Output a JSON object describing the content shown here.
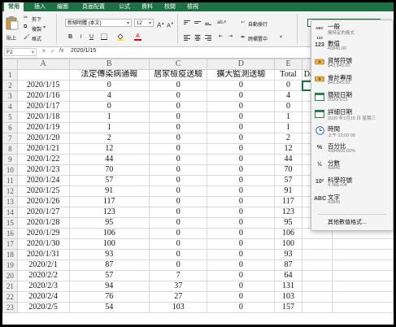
{
  "ribbon_tabs": [
    "常用",
    "插入",
    "繪圖",
    "頁面配置",
    "公式",
    "資料",
    "校閱",
    "檢視"
  ],
  "clipboard": {
    "paste": "貼上",
    "cut": "剪下",
    "copy": "複製",
    "format": "格式"
  },
  "font": {
    "name": "新細明體 (本文)",
    "size": "12"
  },
  "wrap_text": "自動換行",
  "merge_center": "跨欄置中",
  "formula_bar": {
    "cell_ref": "F2",
    "fx": "fx",
    "value": "2020/1/15"
  },
  "columns": [
    "A",
    "B",
    "C",
    "D",
    "E"
  ],
  "headers": {
    "b": "法定傳染病通報",
    "c": "居家檢疫送驗",
    "d": "擴大監測送驗",
    "e": "Total",
    "f": "Day"
  },
  "rows": [
    {
      "n": "2",
      "date": "2020/1/15",
      "b": "0",
      "c": "0",
      "d": "0",
      "e": "0"
    },
    {
      "n": "3",
      "date": "2020/1/16",
      "b": "4",
      "c": "0",
      "d": "0",
      "e": "4"
    },
    {
      "n": "4",
      "date": "2020/1/17",
      "b": "0",
      "c": "0",
      "d": "0",
      "e": "0"
    },
    {
      "n": "5",
      "date": "2020/1/18",
      "b": "1",
      "c": "0",
      "d": "0",
      "e": "1"
    },
    {
      "n": "6",
      "date": "2020/1/19",
      "b": "1",
      "c": "0",
      "d": "0",
      "e": "1"
    },
    {
      "n": "7",
      "date": "2020/1/20",
      "b": "2",
      "c": "0",
      "d": "0",
      "e": "2"
    },
    {
      "n": "8",
      "date": "2020/1/21",
      "b": "12",
      "c": "0",
      "d": "0",
      "e": "12"
    },
    {
      "n": "9",
      "date": "2020/1/22",
      "b": "44",
      "c": "0",
      "d": "0",
      "e": "44"
    },
    {
      "n": "10",
      "date": "2020/1/23",
      "b": "70",
      "c": "0",
      "d": "0",
      "e": "70"
    },
    {
      "n": "11",
      "date": "2020/1/24",
      "b": "57",
      "c": "0",
      "d": "0",
      "e": "57"
    },
    {
      "n": "12",
      "date": "2020/1/25",
      "b": "91",
      "c": "0",
      "d": "0",
      "e": "91"
    },
    {
      "n": "13",
      "date": "2020/1/26",
      "b": "117",
      "c": "0",
      "d": "0",
      "e": "117"
    },
    {
      "n": "14",
      "date": "2020/1/27",
      "b": "123",
      "c": "0",
      "d": "0",
      "e": "123"
    },
    {
      "n": "15",
      "date": "2020/1/28",
      "b": "95",
      "c": "0",
      "d": "0",
      "e": "95"
    },
    {
      "n": "16",
      "date": "2020/1/29",
      "b": "106",
      "c": "0",
      "d": "0",
      "e": "106"
    },
    {
      "n": "17",
      "date": "2020/1/30",
      "b": "100",
      "c": "0",
      "d": "0",
      "e": "100"
    },
    {
      "n": "18",
      "date": "2020/1/31",
      "b": "93",
      "c": "0",
      "d": "0",
      "e": "93"
    },
    {
      "n": "19",
      "date": "2020/2/1",
      "b": "87",
      "c": "0",
      "d": "0",
      "e": "87"
    },
    {
      "n": "20",
      "date": "2020/2/2",
      "b": "57",
      "c": "7",
      "d": "0",
      "e": "64"
    },
    {
      "n": "21",
      "date": "2020/2/3",
      "b": "94",
      "c": "37",
      "d": "0",
      "e": "131"
    },
    {
      "n": "22",
      "date": "2020/2/4",
      "b": "76",
      "c": "27",
      "d": "0",
      "e": "103"
    },
    {
      "n": "23",
      "date": "2020/2/5",
      "b": "54",
      "c": "103",
      "d": "0",
      "e": "157"
    }
  ],
  "number_format_menu": {
    "items": [
      {
        "icon": "ABC 123",
        "name": "一般",
        "sample": "無特定的格式"
      },
      {
        "icon": "123",
        "name": "數值",
        "sample": "43845.00"
      },
      {
        "icon": "$",
        "name": "貨幣符號",
        "sample": "$43,845.00"
      },
      {
        "icon": "$",
        "name": "會計專用",
        "sample": "$43,845.00"
      },
      {
        "icon": "cal",
        "name": "簡短日期",
        "sample": "2020/1/15"
      },
      {
        "icon": "cal",
        "name": "詳細日期",
        "sample": "2020 年1月15 日 星期三"
      },
      {
        "icon": "clock",
        "name": "時間",
        "sample": "上午 12:00:00"
      },
      {
        "icon": "%",
        "name": "百分比",
        "sample": "4384500.00%"
      },
      {
        "icon": "½",
        "name": "分數",
        "sample": "43845"
      },
      {
        "icon": "10²",
        "name": "科學符號",
        "sample": "4.38E+04"
      },
      {
        "icon": "ABC",
        "name": "文字",
        "sample": "43845"
      }
    ],
    "more": "其他數值格式..."
  },
  "accent_color": "#1e7145"
}
